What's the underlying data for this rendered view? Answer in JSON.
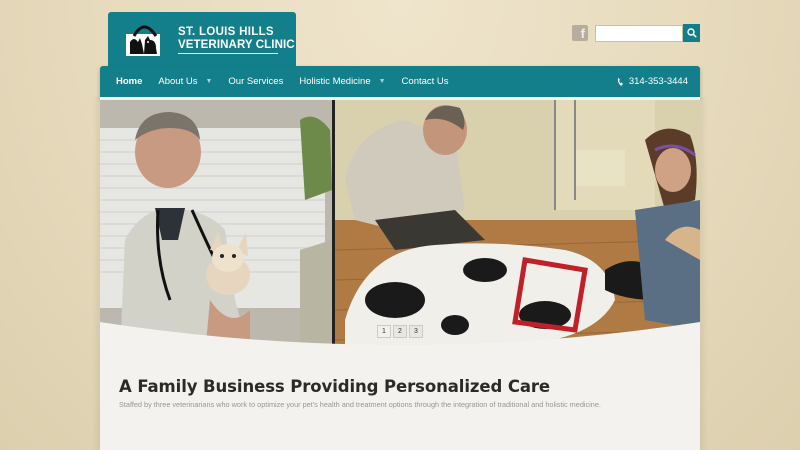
{
  "logo": {
    "line1": "ST. LOUIS HILLS",
    "line2": "VETERINARY CLINIC"
  },
  "header": {
    "social_icon": "facebook-icon",
    "social_letter": "f",
    "search": {
      "value": "",
      "placeholder": "",
      "button_icon": "search-icon"
    }
  },
  "nav": {
    "items": [
      {
        "label": "Home",
        "active": true,
        "dropdown": false
      },
      {
        "label": "About Us",
        "active": false,
        "dropdown": true
      },
      {
        "label": "Our Services",
        "active": false,
        "dropdown": false
      },
      {
        "label": "Holistic Medicine",
        "active": false,
        "dropdown": true
      },
      {
        "label": "Contact Us",
        "active": false,
        "dropdown": false
      }
    ],
    "phone": "314-353-3444",
    "phone_icon": "phone-icon"
  },
  "slider": {
    "images": [
      {
        "alt": "Veterinarian holding a small chihuahua puppy"
      },
      {
        "alt": "Veterinary staff examining a Great Dane lying on the floor"
      }
    ],
    "pages": [
      "1",
      "2",
      "3"
    ],
    "current_page": 1
  },
  "main": {
    "headline": "A Family Business Providing Personalized Care",
    "subline": "Staffed by three veterinarians who work to optimize your pet's health and treatment options through the integration of traditional and holistic medicine."
  },
  "colors": {
    "brand_teal": "#137f8a",
    "background": "#e8dcc0",
    "content_bg": "#f4f2ee"
  }
}
